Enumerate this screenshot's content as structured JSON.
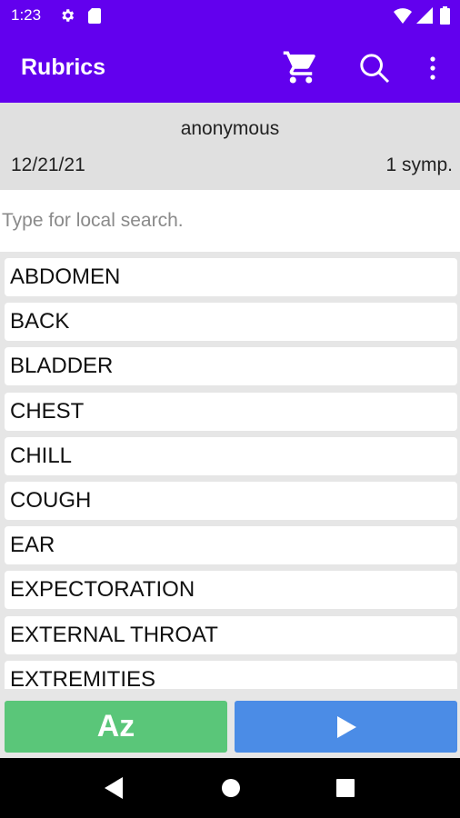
{
  "status_bar": {
    "time": "1:23",
    "icons": [
      "gear-icon",
      "sd-card-icon",
      "wifi-icon",
      "signal-icon",
      "battery-icon"
    ]
  },
  "app_bar": {
    "title": "Rubrics",
    "actions": [
      "cart-icon",
      "search-icon",
      "more-vert-icon"
    ]
  },
  "info": {
    "user": "anonymous",
    "date": "12/21/21",
    "symptom_count": "1 symp."
  },
  "search": {
    "placeholder": "Type for local search.",
    "value": ""
  },
  "rubrics": [
    "ABDOMEN",
    "BACK",
    "BLADDER",
    "CHEST",
    "CHILL",
    "COUGH",
    "EAR",
    "EXPECTORATION",
    "EXTERNAL THROAT",
    "EXTREMITIES"
  ],
  "bottom": {
    "sort_label": "Az",
    "play_icon": "play-icon"
  },
  "nav": [
    "back-icon",
    "home-icon",
    "recents-icon"
  ],
  "colors": {
    "primary": "#6200ee",
    "sort_button": "#5ac679",
    "play_button": "#4b8ce6"
  }
}
